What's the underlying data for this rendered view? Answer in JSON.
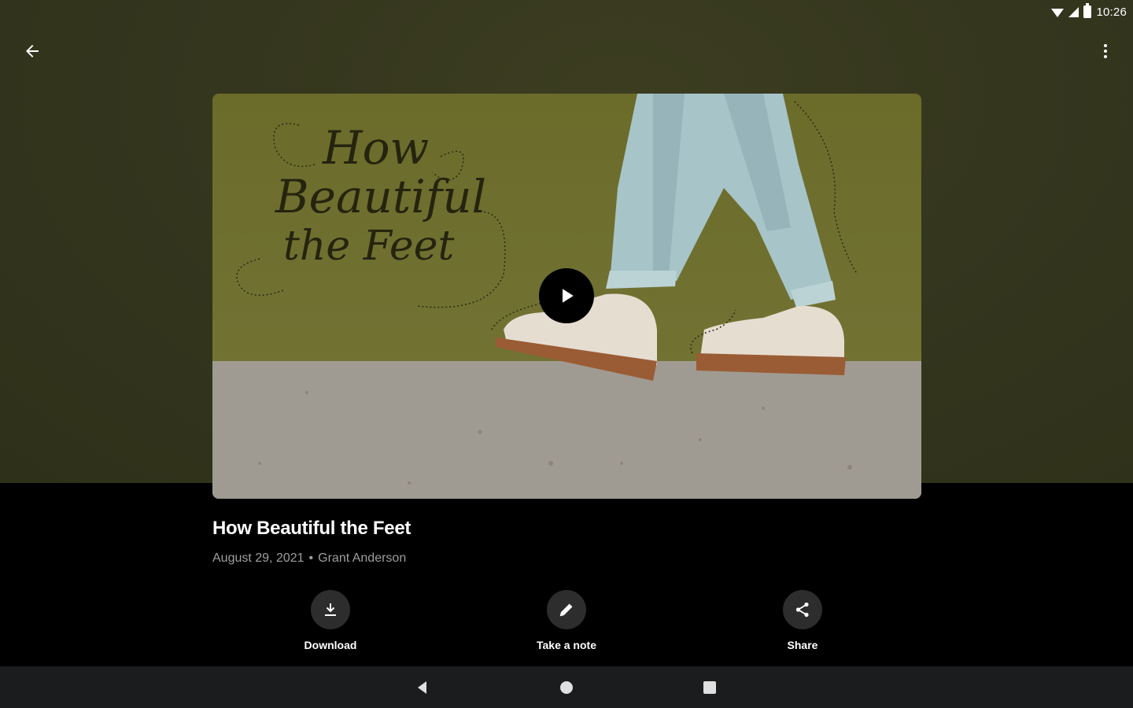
{
  "status_bar": {
    "time": "10:26"
  },
  "video": {
    "artwork_text": [
      "How",
      "Beautiful",
      "the Feet"
    ],
    "colors": {
      "backdrop": "#34361e",
      "artwork_green": "#6f7030"
    }
  },
  "sermon": {
    "title": "How Beautiful the Feet",
    "date": "August 29, 2021",
    "separator": "•",
    "speaker": "Grant Anderson"
  },
  "actions": {
    "download": "Download",
    "note": "Take a note",
    "share": "Share"
  },
  "icons": [
    "back-arrow-icon",
    "more-vert-icon",
    "play-icon",
    "download-icon",
    "pencil-icon",
    "share-icon"
  ]
}
